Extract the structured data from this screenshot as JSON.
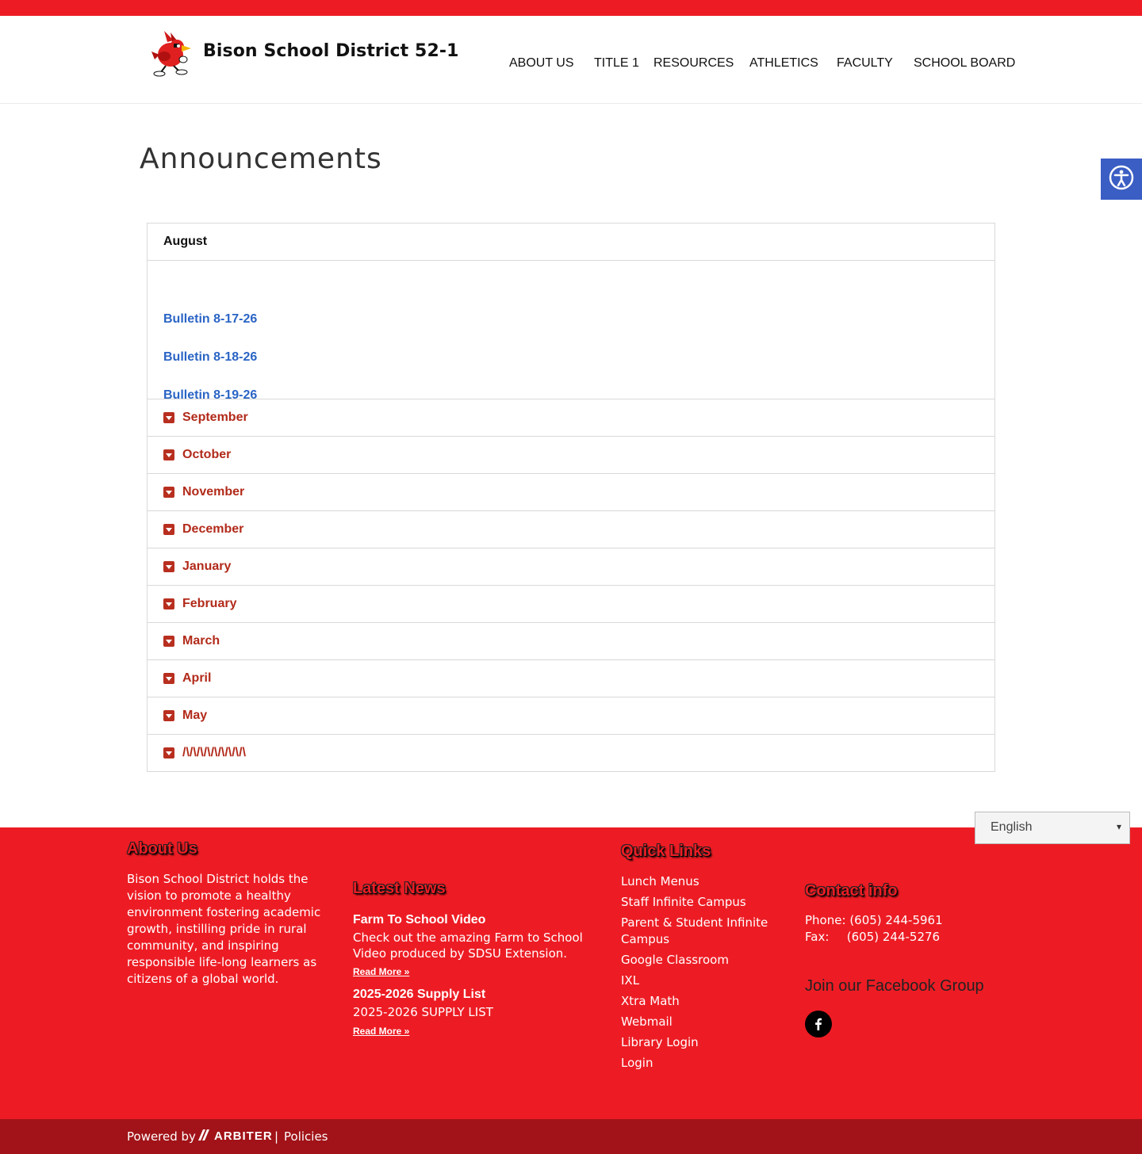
{
  "header": {
    "site_title": "Bison School District 52-1",
    "nav": [
      "ABOUT US",
      "TITLE 1",
      "RESOURCES",
      "ATHLETICS",
      "FACULTY",
      "SCHOOL BOARD"
    ]
  },
  "page": {
    "title": "Announcements"
  },
  "accordion": {
    "open_section": {
      "label": "August",
      "links": [
        "Bulletin 8-17-26",
        "Bulletin 8-18-26",
        "Bulletin 8-19-26"
      ]
    },
    "collapsed": [
      "September",
      "October",
      "November",
      "December",
      "January",
      "February",
      "March",
      "April",
      "May",
      "/\\/\\/\\/\\/\\/\\/\\/\\/\\"
    ]
  },
  "language_select": {
    "selected": "English"
  },
  "footer": {
    "about": {
      "heading": "About Us",
      "text": "Bison School District holds the vision to promote a healthy environment fostering academic growth, instilling pride in rural community, and inspiring responsible life-long learners as citizens of a global world."
    },
    "news": {
      "heading": "Latest News",
      "items": [
        {
          "title": "Farm To School Video",
          "summary": "Check out the amazing Farm to School Video produced by  SDSU Extension.",
          "link": "Read More »"
        },
        {
          "title": "2025-2026 Supply List",
          "summary": "2025-2026 SUPPLY LIST",
          "link": "Read More »"
        }
      ]
    },
    "quick_links": {
      "heading": "Quick Links",
      "items": [
        "Lunch Menus",
        "Staff Infinite Campus",
        "Parent & Student Infinite Campus",
        "Google Classroom",
        "IXL",
        "Xtra Math",
        "Webmail",
        "Library Login",
        "Login"
      ]
    },
    "contact": {
      "heading": "Contact info",
      "phone_label": "Phone:",
      "phone": "(605) 244-5961",
      "fax_label": "Fax:",
      "fax": "(605) 244-5276",
      "facebook_heading": "Join our Facebook Group"
    }
  },
  "bottom_bar": {
    "powered_by": "Powered by",
    "brand": "ARBITER",
    "separator": "|",
    "policies": "Policies"
  },
  "colors": {
    "brand_red": "#ed1c24",
    "dark_red": "#a11318",
    "link_blue": "#2a64c5",
    "accordion_red": "#b22a1a",
    "a11y_blue": "#3b5ec4"
  }
}
